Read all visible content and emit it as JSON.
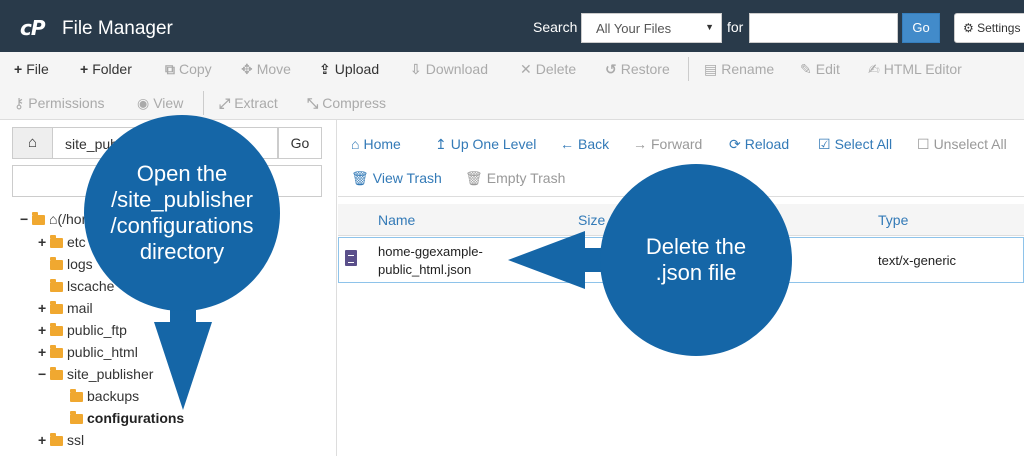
{
  "header": {
    "logo": "cP",
    "title": "File Manager",
    "search_label": "Search",
    "scope_value": "All Your Files",
    "for_label": "for",
    "search_value": "",
    "go_label": "Go",
    "settings_label": "Settings"
  },
  "toolbar": {
    "row1": [
      {
        "label": "File",
        "icon": "+",
        "enabled": true
      },
      {
        "label": "Folder",
        "icon": "+",
        "enabled": true
      },
      {
        "label": "Copy",
        "icon": "⧉",
        "enabled": false
      },
      {
        "label": "Move",
        "icon": "✥",
        "enabled": false
      },
      {
        "label": "Upload",
        "icon": "⇪",
        "enabled": true
      },
      {
        "label": "Download",
        "icon": "⇩",
        "enabled": false
      },
      {
        "label": "Delete",
        "icon": "✕",
        "enabled": false
      },
      {
        "label": "Restore",
        "icon": "↺",
        "enabled": false
      },
      {
        "label": "Rename",
        "icon": "▤",
        "enabled": false
      },
      {
        "label": "Edit",
        "icon": "✎",
        "enabled": false
      },
      {
        "label": "HTML Editor",
        "icon": "✍",
        "enabled": false
      }
    ],
    "row2": [
      {
        "label": "Permissions",
        "icon": "⚷",
        "enabled": false
      },
      {
        "label": "View",
        "icon": "◉",
        "enabled": false
      },
      {
        "label": "Extract",
        "icon": "⤢",
        "enabled": false
      },
      {
        "label": "Compress",
        "icon": "⤡",
        "enabled": false
      }
    ]
  },
  "tree": {
    "path_value": "site_publisher",
    "go_label": "Go",
    "filter_value": "",
    "items": [
      {
        "toggle": "−",
        "label": "(/home/ggexample)"
      },
      {
        "toggle": "+",
        "label": "etc"
      },
      {
        "toggle": "",
        "label": "logs"
      },
      {
        "toggle": "",
        "label": "lscache"
      },
      {
        "toggle": "+",
        "label": "mail"
      },
      {
        "toggle": "+",
        "label": "public_ftp"
      },
      {
        "toggle": "+",
        "label": "public_html"
      },
      {
        "toggle": "−",
        "label": "site_publisher"
      },
      {
        "toggle": "",
        "label": "backups"
      },
      {
        "toggle": "",
        "label": "configurations"
      },
      {
        "toggle": "+",
        "label": "ssl"
      }
    ]
  },
  "nav": {
    "row1": [
      {
        "label": "Home",
        "icon": "⌂",
        "enabled": true
      },
      {
        "label": "Up One Level",
        "icon": "↥",
        "enabled": true
      },
      {
        "label": "Back",
        "icon": "←",
        "enabled": true
      },
      {
        "label": "Forward",
        "icon": "→",
        "enabled": false
      },
      {
        "label": "Reload",
        "icon": "⟳",
        "enabled": true
      },
      {
        "label": "Select All",
        "icon": "☑",
        "enabled": true
      },
      {
        "label": "Unselect All",
        "icon": "☐",
        "enabled": false
      }
    ],
    "row2": [
      {
        "label": "View Trash",
        "icon": "🗑",
        "enabled": true
      },
      {
        "label": "Empty Trash",
        "icon": "🗑",
        "enabled": false
      }
    ]
  },
  "file_list": {
    "columns": [
      "Name",
      "Size",
      "Type"
    ],
    "rows": [
      {
        "name": "home-ggexample-public_html.json",
        "type": "text/x-generic"
      }
    ]
  },
  "callouts": {
    "left": "Open the\n/site_publisher\n/configurations\ndirectory",
    "right": "Delete the\n.json file"
  },
  "colors": {
    "header_bg": "#293a4a",
    "accent_blue": "#337ab7",
    "callout_blue": "#1566a7",
    "folder_orange": "#f0a830"
  }
}
